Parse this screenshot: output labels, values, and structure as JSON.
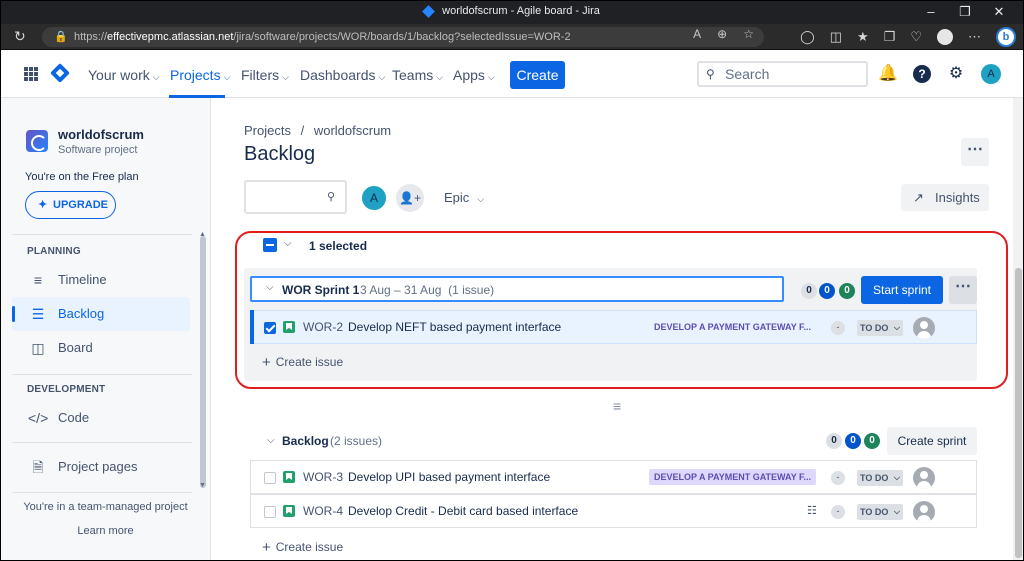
{
  "browser": {
    "tab_title": "worldofscrum - Agile board - Jira",
    "url_prefix": "https://",
    "url_host": "effectivepmc.atlassian.net",
    "url_path": "/jira/software/projects/WOR/boards/1/backlog?selectedIssue=WOR-2"
  },
  "topnav": {
    "your_work": "Your work",
    "projects": "Projects",
    "filters": "Filters",
    "dashboards": "Dashboards",
    "teams": "Teams",
    "apps": "Apps",
    "create": "Create",
    "search_placeholder": "Search",
    "avatar_initial": "A"
  },
  "sidebar": {
    "project_name": "worldofscrum",
    "project_type": "Software project",
    "free_plan": "You're on the Free plan",
    "upgrade": "UPGRADE",
    "planning_header": "PLANNING",
    "timeline": "Timeline",
    "backlog": "Backlog",
    "board": "Board",
    "development_header": "DEVELOPMENT",
    "code": "Code",
    "project_pages": "Project pages",
    "team_managed": "You're in a team-managed project",
    "learn_more": "Learn more"
  },
  "main": {
    "breadcrumb_projects": "Projects",
    "breadcrumb_sep": "/",
    "breadcrumb_project": "worldofscrum",
    "title": "Backlog",
    "avatar_initial": "A",
    "epic_filter": "Epic",
    "insights": "Insights",
    "selected_text": "1 selected",
    "sprint": {
      "name": "WOR Sprint 1",
      "dates": "3 Aug – 31 Aug",
      "count": "(1 issue)",
      "todo_count": "0",
      "inprogress_count": "0",
      "done_count": "0",
      "start_label": "Start sprint",
      "issues": [
        {
          "key": "WOR-2",
          "summary": "Develop NEFT based payment interface",
          "epic": "DEVELOP A PAYMENT GATEWAY F...",
          "estimate": "-",
          "status": "TO DO"
        }
      ],
      "create_issue": "Create issue"
    },
    "backlog": {
      "name": "Backlog",
      "count": "(2 issues)",
      "todo_count": "0",
      "inprogress_count": "0",
      "done_count": "0",
      "create_sprint": "Create sprint",
      "issues": [
        {
          "key": "WOR-3",
          "summary": "Develop UPI based payment interface",
          "epic": "DEVELOP A PAYMENT GATEWAY F...",
          "estimate": "-",
          "status": "TO DO"
        },
        {
          "key": "WOR-4",
          "summary": "Develop Credit - Debit card based interface",
          "epic": "",
          "estimate": "-",
          "status": "TO DO"
        }
      ],
      "create_issue": "Create issue"
    }
  },
  "colors": {
    "accent": "#0c66e4",
    "highlight_border": "#e01e1e",
    "epic_bg": "#dfd8fd",
    "epic_text": "#5e4db2",
    "story_green": "#22a06b"
  },
  "icons": {
    "apps_grid": "apps-grid-icon",
    "notifications": "bell-icon",
    "help": "help-icon",
    "settings": "gear-icon",
    "insights": "insights-chart-icon",
    "story": "story-icon",
    "child_issues": "child-issues-icon"
  }
}
